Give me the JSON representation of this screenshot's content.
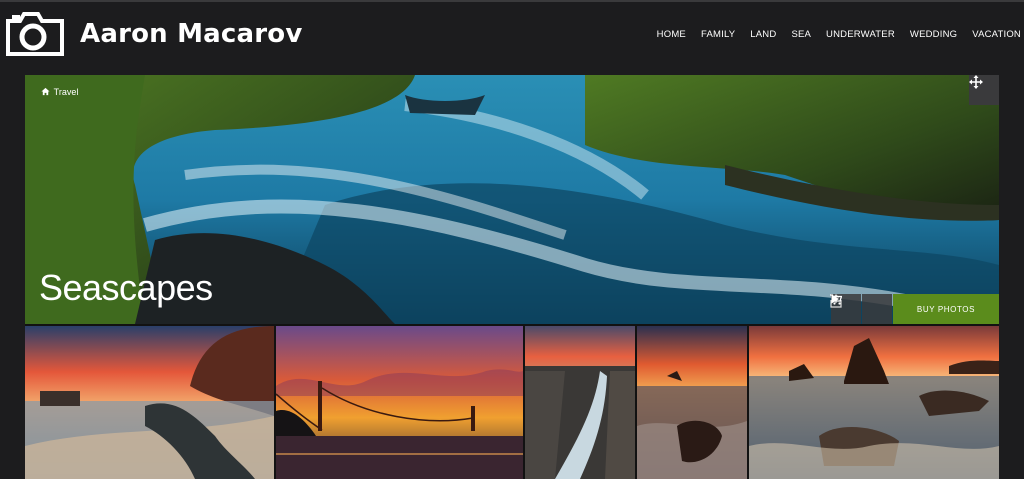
{
  "site": {
    "title": "Aaron Macarov"
  },
  "nav": [
    "HOME",
    "FAMILY",
    "LAND",
    "SEA",
    "UNDERWATER",
    "WEDDING",
    "VACATION"
  ],
  "breadcrumb": {
    "current": "Travel"
  },
  "hero": {
    "title": "Seascapes"
  },
  "actions": {
    "buy_label": "BUY PHOTOS"
  },
  "colors": {
    "background": "#1c1c1e",
    "buy_button": "#5b8c1c",
    "panel": "#3a3a3c"
  }
}
